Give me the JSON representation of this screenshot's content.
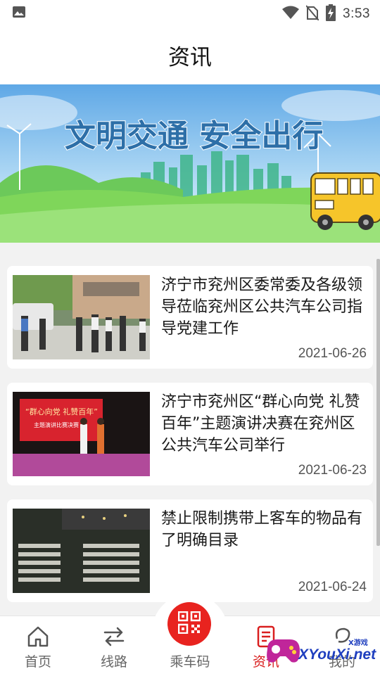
{
  "status_bar": {
    "time": "3:53"
  },
  "header": {
    "title": "资讯"
  },
  "banner": {
    "slogan": "文明交通  安全出行"
  },
  "news": [
    {
      "title": "济宁市兖州区委常委及各级领导莅临兖州区公共汽车公司指导党建工作",
      "date": "2021-06-26"
    },
    {
      "title": "济宁市兖州区“群心向党 礼赞百年”主题演讲决赛在兖州区公共汽车公司举行",
      "date": "2021-06-23"
    },
    {
      "title": "禁止限制携带上客车的物品有了明确目录",
      "date": "2021-06-24"
    }
  ],
  "thumb2": {
    "stage_text_1": "“群心向党 礼赞百年”",
    "stage_text_2": "主题演讲比赛决赛"
  },
  "tabs": [
    {
      "label": "首页"
    },
    {
      "label": "线路"
    },
    {
      "label": "乘车码"
    },
    {
      "label": "资讯"
    },
    {
      "label": "我的"
    }
  ],
  "watermark": {
    "text": "XYouXi.net",
    "small": "X游戏"
  },
  "colors": {
    "accent": "#d91e1e",
    "qr_button": "#e8231f"
  }
}
